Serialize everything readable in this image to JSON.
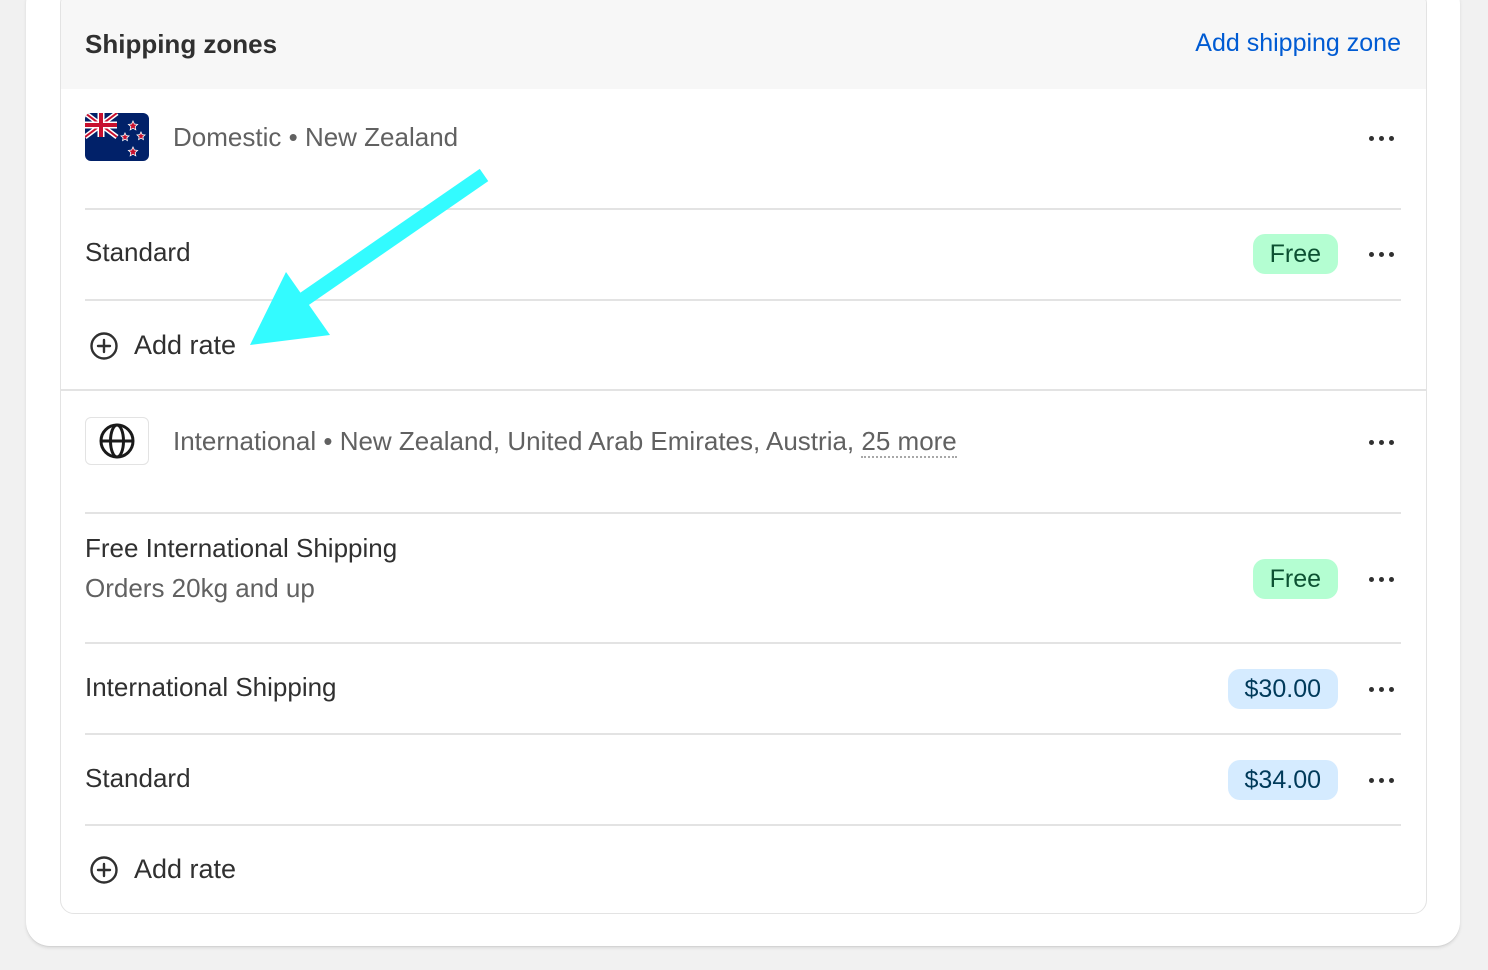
{
  "header": {
    "title": "Shipping zones",
    "add_zone_label": "Add shipping zone"
  },
  "zones": [
    {
      "icon": "new-zealand-flag-icon",
      "name": "Domestic",
      "separator": "•",
      "regions": "New Zealand",
      "rates": [
        {
          "name": "Standard",
          "price": "Free"
        }
      ],
      "add_rate_label": "Add rate"
    },
    {
      "icon": "globe-icon",
      "name": "International",
      "separator": "•",
      "regions": "New Zealand, United Arab Emirates, Austria,",
      "more_regions": "25 more",
      "rates": [
        {
          "name": "Free International Shipping",
          "condition": "Orders 20kg and up",
          "price": "Free"
        },
        {
          "name": "International Shipping",
          "price": "$30.00"
        },
        {
          "name": "Standard",
          "price": "$34.00"
        }
      ],
      "add_rate_label": "Add rate"
    }
  ],
  "colors": {
    "accent_link": "#005bd3",
    "free_badge_bg": "#b4fed2",
    "price_badge_bg": "#d5ebff",
    "annotation_arrow": "#33fbff"
  }
}
